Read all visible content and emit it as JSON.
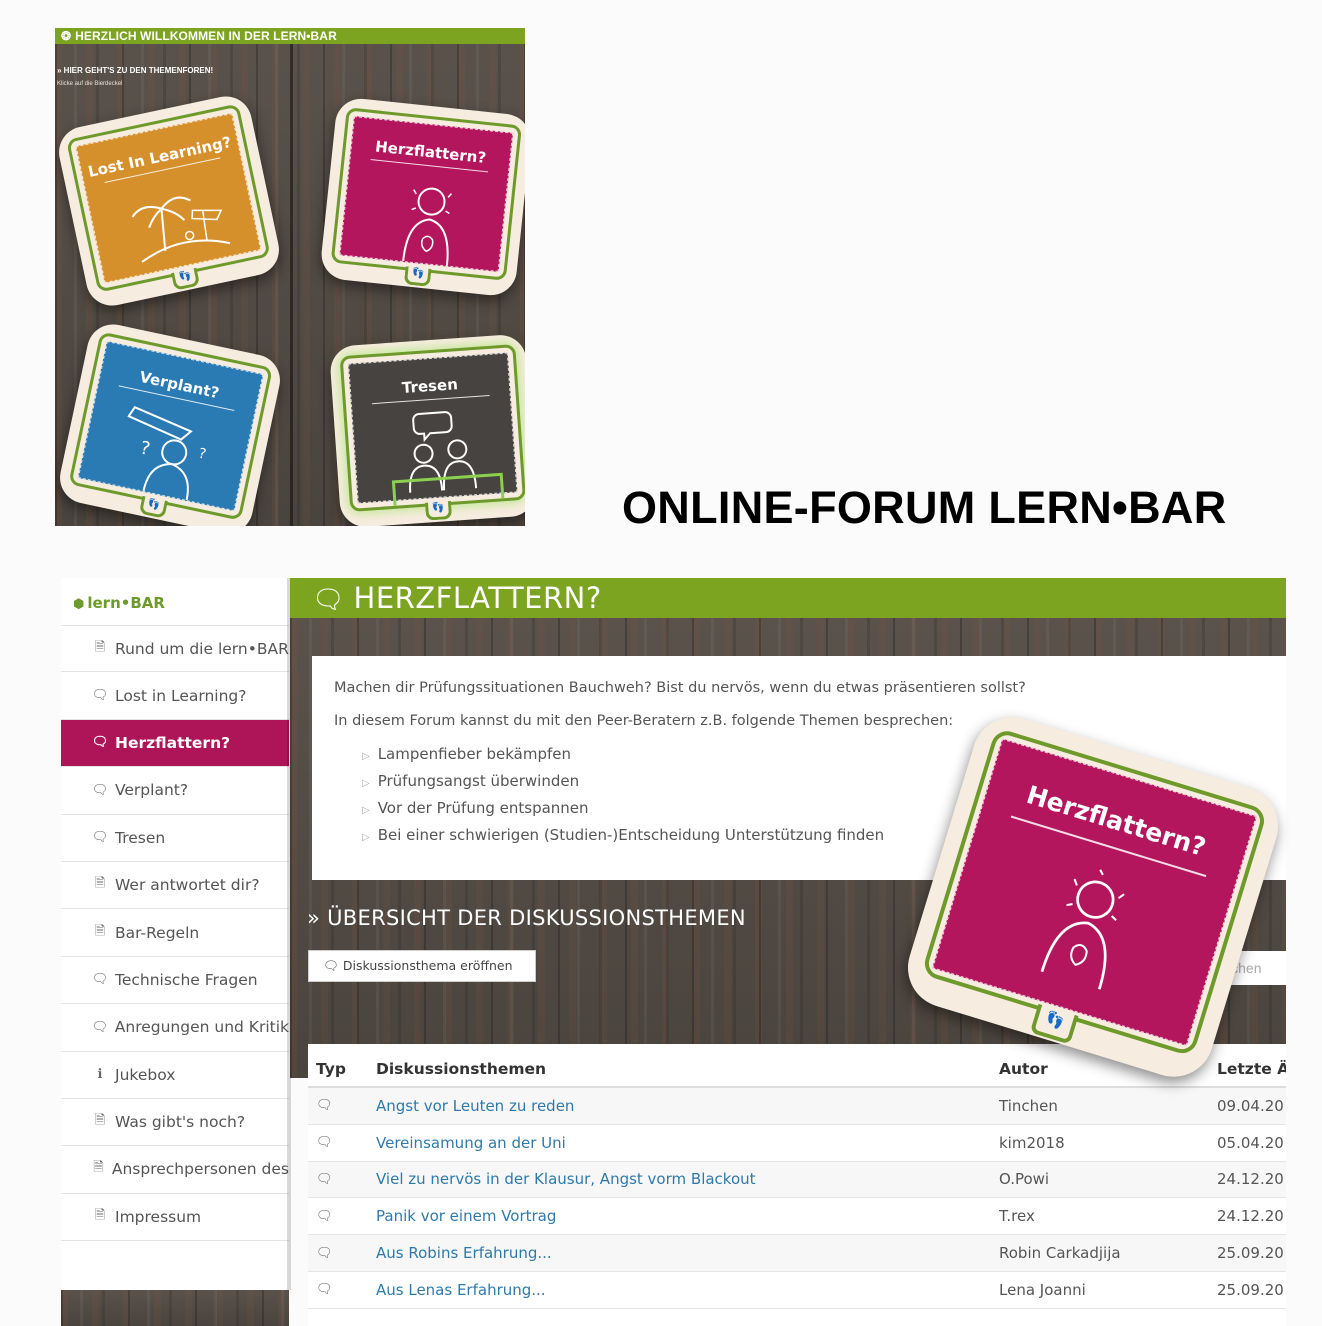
{
  "top_panel": {
    "header": "HERZLICH WILLKOMMEN IN DER LERN•BAR",
    "subheader": "» HIER GEHT'S ZU DEN THEMENFOREN!",
    "hint": "Klicke auf die Bierdeckel",
    "coasters": [
      {
        "title": "Lost In Learning?",
        "color": "#d6902b",
        "tab": "👣"
      },
      {
        "title": "Herzflattern?",
        "color": "#b4165e",
        "tab": "👣"
      },
      {
        "title": "Verplant?",
        "color": "#2a7bb3",
        "tab": "👣"
      },
      {
        "title": "Tresen",
        "color": "#464340",
        "tab": "👣"
      }
    ]
  },
  "big_title": "ONLINE-FORUM LERN•BAR",
  "sidebar": {
    "brand": "lern•BAR",
    "items": [
      {
        "label": "Rund um die lern•BAR",
        "icon": "doc-icon"
      },
      {
        "label": "Lost in Learning?",
        "icon": "chat-icon"
      },
      {
        "label": "Herzflattern?",
        "icon": "chat-icon",
        "active": true
      },
      {
        "label": "Verplant?",
        "icon": "chat-icon"
      },
      {
        "label": "Tresen",
        "icon": "chat-icon"
      },
      {
        "label": "Wer antwortet dir?",
        "icon": "doc-icon"
      },
      {
        "label": "Bar-Regeln",
        "icon": "doc-icon"
      },
      {
        "label": "Technische Fragen",
        "icon": "chat-icon"
      },
      {
        "label": "Anregungen und Kritik",
        "icon": "chat-icon"
      },
      {
        "label": "Jukebox",
        "icon": "info-icon"
      },
      {
        "label": "Was gibt's noch?",
        "icon": "doc-icon"
      },
      {
        "label": "Ansprechpersonen des",
        "icon": "doc-icon"
      },
      {
        "label": "Impressum",
        "icon": "doc-icon"
      }
    ]
  },
  "main": {
    "title": "HERZFLATTERN?",
    "intro_line1": "Machen dir Prüfungssituationen Bauchweh? Bist du nervös, wenn du etwas präsentieren sollst?",
    "intro_line2": "In diesem Forum kannst du mit den Peer-Beratern z.B. folgende Themen besprechen:",
    "topics": [
      "Lampenfieber bekämpfen",
      "Prüfungsangst überwinden",
      "Vor der Prüfung entspannen",
      "Bei einer schwierigen (Studien-)Entscheidung Unterstützung finden"
    ],
    "section_title": "» ÜBERSICHT DER DISKUSSIONSTHEMEN",
    "new_topic_button": "Diskussionsthema eröffnen",
    "search_placeholder": "Suchen",
    "coaster_title": "Herzflattern?",
    "coaster_tab": "👣"
  },
  "table": {
    "headers": {
      "typ": "Typ",
      "title": "Diskussionsthemen",
      "author": "Autor",
      "date": "Letzte Ä"
    },
    "rows": [
      {
        "title": "Angst vor Leuten zu reden",
        "author": "Tinchen",
        "date": "09.04.20"
      },
      {
        "title": "Vereinsamung an der Uni",
        "author": "kim2018",
        "date": "05.04.20"
      },
      {
        "title": "Viel zu nervös in der Klausur, Angst vorm Blackout",
        "author": "O.Powi",
        "date": "24.12.20"
      },
      {
        "title": "Panik vor einem Vortrag",
        "author": "T.rex",
        "date": "24.12.20"
      },
      {
        "title": "Aus Robins Erfahrung...",
        "author": "Robin Carkadjija",
        "date": "25.09.20"
      },
      {
        "title": "Aus Lenas Erfahrung...",
        "author": "Lena Joanni",
        "date": "25.09.20"
      }
    ]
  }
}
